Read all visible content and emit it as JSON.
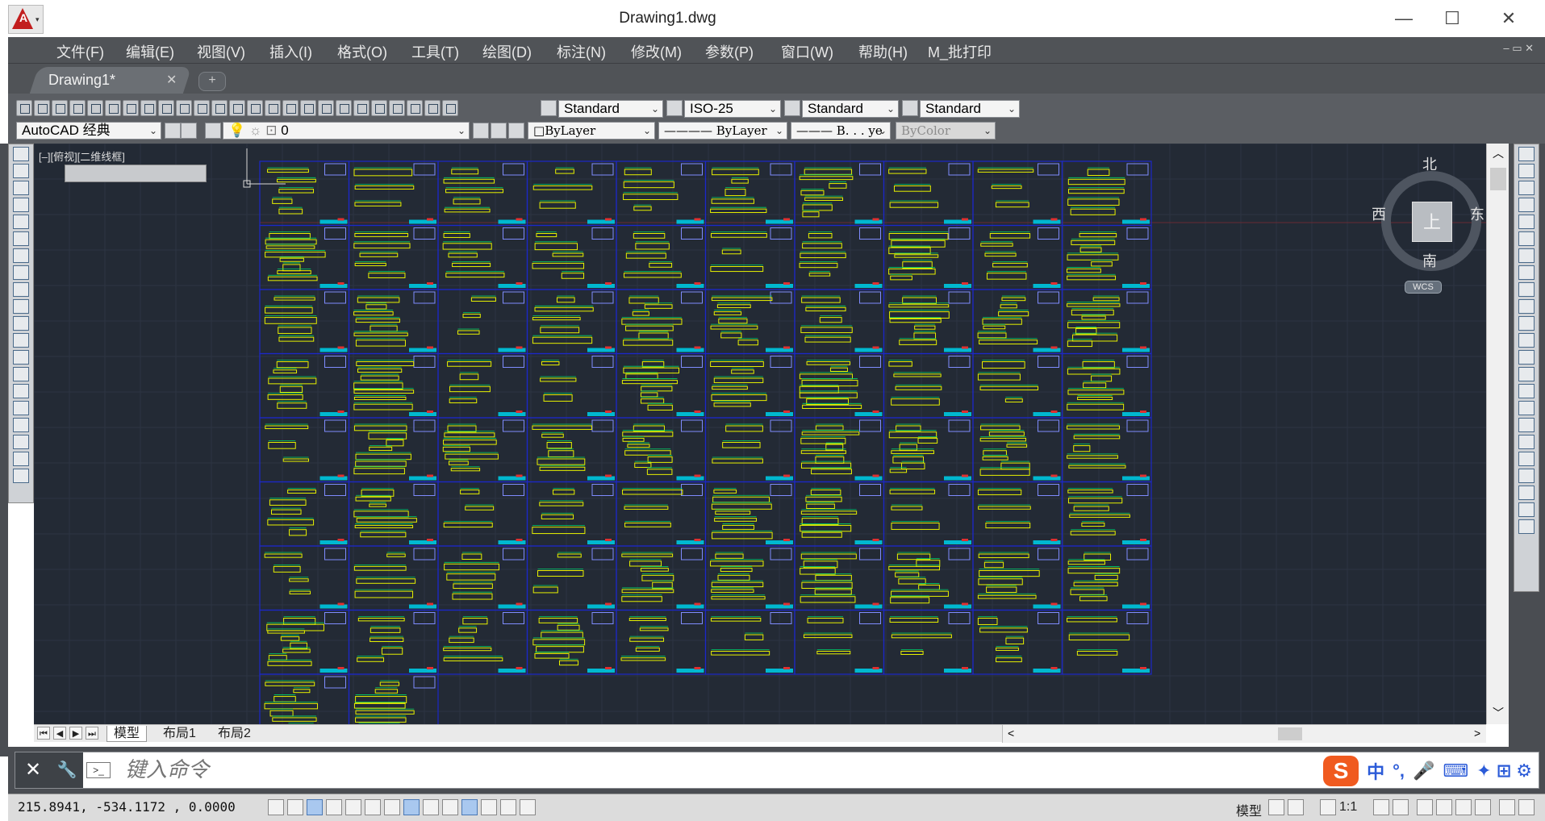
{
  "titlebar": {
    "title": "Drawing1.dwg",
    "minimize": "—",
    "maximize": "☐",
    "close": "✕"
  },
  "app_button": {
    "caret": "▾",
    "logo_letter": "A"
  },
  "menubar": {
    "items": [
      "文件(F)",
      "编辑(E)",
      "视图(V)",
      "插入(I)",
      "格式(O)",
      "工具(T)",
      "绘图(D)",
      "标注(N)",
      "修改(M)",
      "参数(P)",
      "窗口(W)",
      "帮助(H)",
      "M_批打印"
    ],
    "mdi_controls": "–  ▭  ✕"
  },
  "tabs": {
    "document_tab": "Drawing1*",
    "close": "✕",
    "new_tab": "+"
  },
  "toolbar_row1": {
    "text_style": "Standard",
    "dim_style": "ISO-25",
    "table_style": "Standard",
    "multileader_style": "Standard"
  },
  "toolbar_row2": {
    "workspace": "AutoCAD 经典",
    "layer": "0",
    "color": "ByLayer",
    "linetype": "ByLayer",
    "lineweight": "B. . . ye",
    "plotstyle": "ByColor"
  },
  "viewport": {
    "label": "[–][俯视][二维线框]",
    "ucs_icon": "Y X"
  },
  "viewcube": {
    "north": "北",
    "south": "南",
    "east": "东",
    "west": "西",
    "face": "上",
    "wcs": "WCS"
  },
  "layout_tabs": {
    "items": [
      "模型",
      "布局1",
      "布局2"
    ],
    "nav": [
      "⏮",
      "◀",
      "▶",
      "⏭"
    ],
    "hscroll_left": "<",
    "hscroll_right": ">"
  },
  "vscroll": {
    "up": "︿",
    "down": "﹀"
  },
  "command_line": {
    "close": "✕",
    "wrench": "🔧",
    "prompt_icon": ">_",
    "placeholder": "键入命令"
  },
  "ime": {
    "logo": "S",
    "lang": "中",
    "punct": "°,",
    "mic": "🎤",
    "keyboard": "⌨",
    "tools": "✦ ⊞ ⚙"
  },
  "statusbar": {
    "coordinates": "215.8941,   -534.1172 ,  0.0000",
    "model_label": "模型",
    "annotation_scale": "1:1"
  },
  "colors": {
    "accent": "#c21d1d",
    "viewport_bg": "#232a35",
    "sheet_border": "#1c28c8",
    "geometry": "#e6f000",
    "dims": "#00d46a"
  },
  "drawing": {
    "sheet_columns": 10,
    "sheet_rows": 8,
    "extra_bottom_row_sheets": 2
  }
}
